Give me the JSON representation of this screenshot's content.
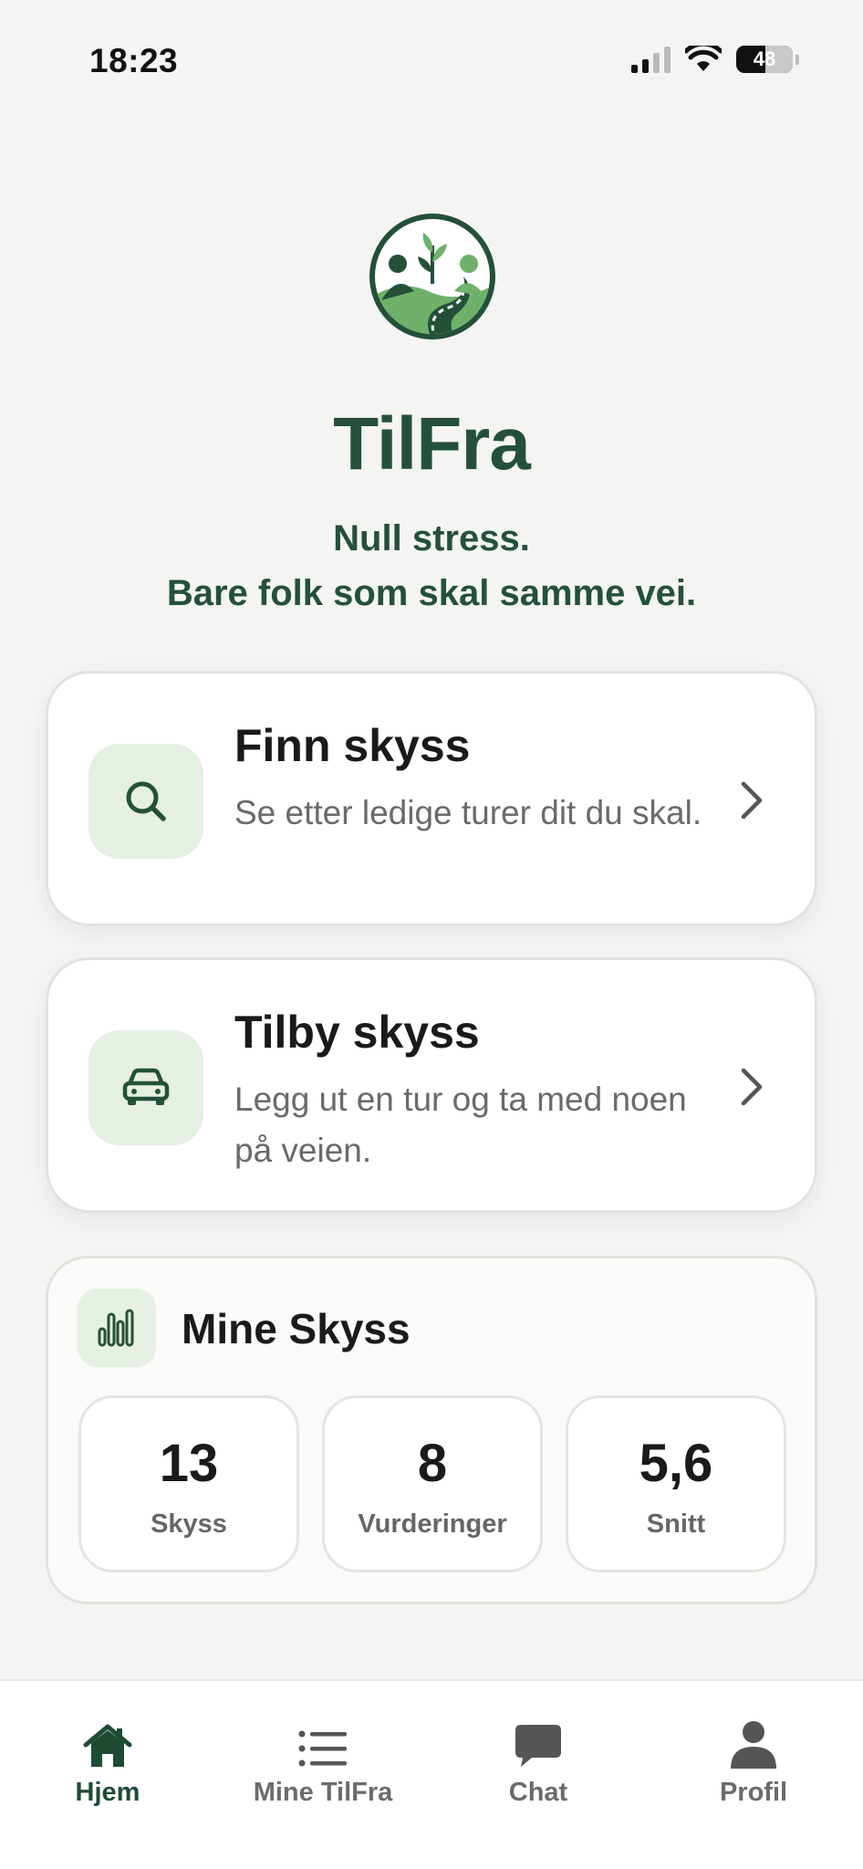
{
  "status_bar": {
    "time": "18:23",
    "battery": "48"
  },
  "header": {
    "app_name": "TilFra",
    "tagline_line1": "Null stress.",
    "tagline_line2": "Bare folk som skal samme vei."
  },
  "actions": [
    {
      "title": "Finn skyss",
      "description": "Se etter ledige turer dit du skal.",
      "icon": "search-icon"
    },
    {
      "title": "Tilby skyss",
      "description": "Legg ut en tur og ta med noen på veien.",
      "icon": "car-icon"
    }
  ],
  "stats": {
    "title": "Mine Skyss",
    "icon": "bar-chart-icon",
    "items": [
      {
        "value": "13",
        "label": "Skyss"
      },
      {
        "value": "8",
        "label": "Vurderinger"
      },
      {
        "value": "5,6",
        "label": "Snitt"
      }
    ]
  },
  "tabs": [
    {
      "label": "Hjem",
      "icon": "home-icon",
      "active": true
    },
    {
      "label": "Mine TilFra",
      "icon": "list-icon",
      "active": false
    },
    {
      "label": "Chat",
      "icon": "chat-icon",
      "active": false
    },
    {
      "label": "Profil",
      "icon": "person-icon",
      "active": false
    }
  ],
  "colors": {
    "brand_dark": "#24503a",
    "brand_light": "#6fb06a",
    "icon_tint_bg": "#e5efe4",
    "background": "#f4f5f3"
  }
}
